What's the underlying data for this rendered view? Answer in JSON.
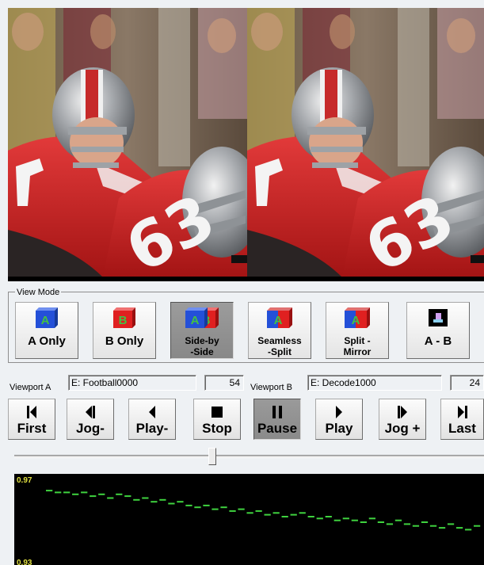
{
  "view_mode": {
    "label": "View Mode",
    "buttons": [
      {
        "id": "a-only",
        "label": "A Only",
        "active": false
      },
      {
        "id": "b-only",
        "label": "B Only",
        "active": false
      },
      {
        "id": "side-by-side",
        "label": "Side-by\n-Side",
        "active": true
      },
      {
        "id": "seamless-split",
        "label": "Seamless\n-Split",
        "active": false
      },
      {
        "id": "split-mirror",
        "label": "Split -\nMirror",
        "active": false
      },
      {
        "id": "a-minus-b",
        "label": "A - B",
        "active": false
      }
    ]
  },
  "viewport_a": {
    "label": "Viewport A",
    "file": "E: Football0000",
    "frame": "54"
  },
  "viewport_b": {
    "label": "Viewport B",
    "file": "E: Decode1000",
    "frame": "24"
  },
  "transport": {
    "buttons": [
      {
        "id": "first",
        "label": "First",
        "active": false
      },
      {
        "id": "jog-back",
        "label": "Jog-",
        "active": false
      },
      {
        "id": "play-back",
        "label": "Play-",
        "active": false
      },
      {
        "id": "stop",
        "label": "Stop",
        "active": false
      },
      {
        "id": "pause",
        "label": "Pause",
        "active": true
      },
      {
        "id": "play",
        "label": "Play",
        "active": false
      },
      {
        "id": "jog-forward",
        "label": "Jog +",
        "active": false
      },
      {
        "id": "last",
        "label": "Last",
        "active": false
      }
    ]
  },
  "slider": {
    "position_fraction": 0.42
  },
  "graph": {
    "y_max_label": "0.97",
    "y_min_label": "0.93",
    "ylim": [
      0.93,
      0.97
    ],
    "values": [
      0.967,
      0.966,
      0.966,
      0.965,
      0.966,
      0.964,
      0.965,
      0.963,
      0.965,
      0.964,
      0.962,
      0.963,
      0.961,
      0.962,
      0.96,
      0.961,
      0.959,
      0.958,
      0.959,
      0.957,
      0.958,
      0.956,
      0.957,
      0.955,
      0.956,
      0.954,
      0.955,
      0.953,
      0.954,
      0.955,
      0.953,
      0.952,
      0.953,
      0.951,
      0.952,
      0.951,
      0.95,
      0.952,
      0.95,
      0.949,
      0.951,
      0.949,
      0.948,
      0.95,
      0.948,
      0.947,
      0.949,
      0.947,
      0.946,
      0.948
    ],
    "series_color": "#3fd23f"
  },
  "colors": {
    "accent_blue": "#2450d8",
    "accent_red": "#e02020",
    "accent_green": "#44c044"
  }
}
